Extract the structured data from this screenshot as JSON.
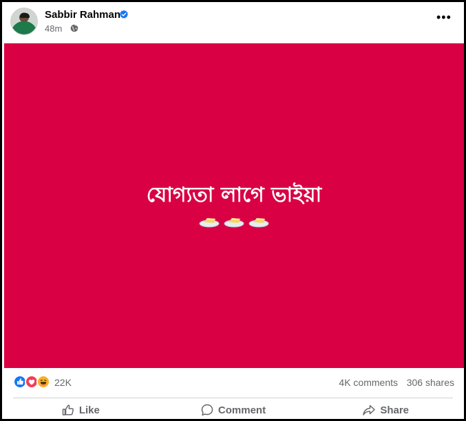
{
  "post": {
    "author": "Sabbir Rahman",
    "time": "48m",
    "text": "যোগ্যতা লাগে ভাইয়া",
    "image_background": "#d90044",
    "emoji": [
      "butter-icon",
      "butter-icon",
      "butter-icon"
    ]
  },
  "stats": {
    "reaction_count": "22K",
    "comments": "4K comments",
    "shares": "306 shares"
  },
  "actions": {
    "like": "Like",
    "comment": "Comment",
    "share": "Share"
  },
  "colors": {
    "verified": "#1877f2",
    "muted_text": "#65676b",
    "like": "#1877f2",
    "love": "#f33e58",
    "haha": "#f7b125"
  }
}
